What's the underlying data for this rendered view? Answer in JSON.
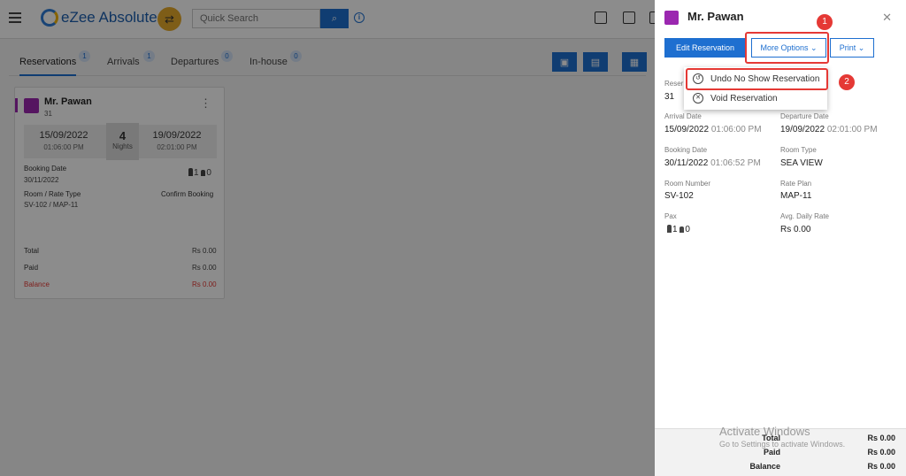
{
  "header": {
    "brand": "eZee Absolute",
    "search_placeholder": "Quick Search"
  },
  "tabs": [
    {
      "label": "Reservations",
      "count": "1"
    },
    {
      "label": "Arrivals",
      "count": "1"
    },
    {
      "label": "Departures",
      "count": "0"
    },
    {
      "label": "In-house",
      "count": "0"
    }
  ],
  "card": {
    "guest_name": "Mr. Pawan",
    "reservation_no": "31",
    "arrival_date": "15/09/2022",
    "arrival_time": "01:06:00 PM",
    "nights_count": "4",
    "nights_label": "Nights",
    "departure_date": "19/09/2022",
    "departure_time": "02:01:00 PM",
    "booking_date_label": "Booking Date",
    "booking_date": "30/11/2022",
    "pax_adults": "1",
    "pax_children": "0",
    "room_rate_label": "Room / Rate Type",
    "room_rate": "SV-102 / MAP-11",
    "status": "Confirm Booking",
    "total_label": "Total",
    "total": "Rs 0.00",
    "paid_label": "Paid",
    "paid": "Rs 0.00",
    "balance_label": "Balance",
    "balance": "Rs 0.00"
  },
  "panel": {
    "guest_name": "Mr. Pawan",
    "edit_label": "Edit Reservation",
    "more_options_label": "More Options",
    "print_label": "Print",
    "reservation_label_partial": "Reser",
    "reservation_no": "31",
    "arrival_label": "Arrival Date",
    "arrival_date": "15/09/2022",
    "arrival_time": "01:06:00 PM",
    "departure_label": "Departure Date",
    "departure_date": "19/09/2022",
    "departure_time": "02:01:00 PM",
    "booking_label": "Booking Date",
    "booking_date": "30/11/2022",
    "booking_time": "01:06:52 PM",
    "room_type_label": "Room Type",
    "room_type": "SEA VIEW",
    "room_number_label": "Room Number",
    "room_number": "SV-102",
    "rate_plan_label": "Rate Plan",
    "rate_plan": "MAP-11",
    "pax_label": "Pax",
    "pax_adults": "1",
    "pax_children": "0",
    "adr_label": "Avg. Daily Rate",
    "adr": "Rs 0.00",
    "total_label": "Total",
    "total": "Rs 0.00",
    "paid_label": "Paid",
    "paid": "Rs 0.00",
    "balance_label": "Balance",
    "balance": "Rs 0.00"
  },
  "dropdown": {
    "undo_no_show": "Undo No Show Reservation",
    "void": "Void Reservation"
  },
  "annotations": {
    "step1": "1",
    "step2": "2"
  },
  "watermark": {
    "line1": "Activate Windows",
    "line2": "Go to Settings to activate Windows."
  },
  "colors": {
    "accent": "#1e6fd0",
    "highlight": "#e53935",
    "room_icon": "#9b27b0"
  }
}
